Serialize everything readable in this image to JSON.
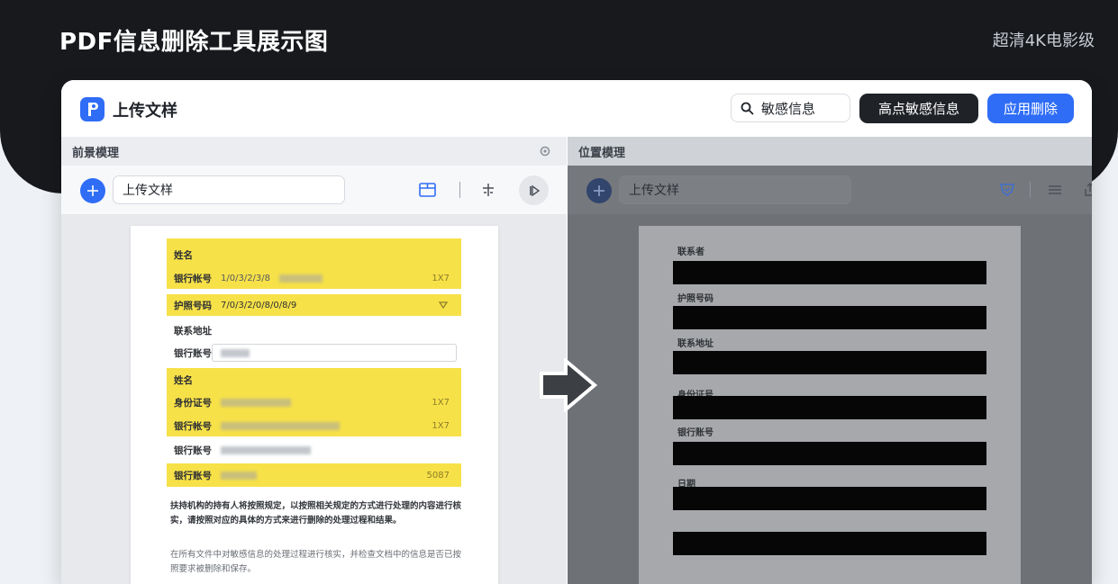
{
  "header": {
    "title": "PDF信息删除工具展示图",
    "quality": "超清4K电影级"
  },
  "app": {
    "name": "上传文样",
    "search_value": "敏感信息",
    "highlight_button": "高点敏感信息",
    "apply_button": "应用删除"
  },
  "left_pane": {
    "title": "前景模理",
    "file_field": "上传文样",
    "document": {
      "highlight_heading_1": "姓名",
      "rows": [
        {
          "label": "银行帐号",
          "value": "1/0/3/2/3/8",
          "code": "1X7"
        },
        {
          "label": "护照号码",
          "value": "7/0/3/2/0/8/0/8/9",
          "code": ""
        },
        {
          "label": "联系地址",
          "value": "",
          "code": ""
        },
        {
          "label": "银行账号",
          "value": "",
          "code": ""
        },
        {
          "label": "身份证号",
          "value": "",
          "code": "1X7"
        },
        {
          "label": "银行帐号",
          "value": "",
          "code": "1X7"
        },
        {
          "label": "银行账号",
          "value": "",
          "code": ""
        },
        {
          "label": "银行账号",
          "value": "",
          "code": "5087"
        }
      ],
      "highlight_heading_2": "姓名",
      "paragraph_1": "扶持机构的持有人将按照规定，以按照相关规定的方式进行处理的内容进行核实，请按照对应的具体的方式来进行删除的处理过程和结果。",
      "paragraph_2": "在所有文件中对敏感信息的处理过程进行核实，并检查文档中的信息是否已按照要求被删除和保存。"
    }
  },
  "right_pane": {
    "title": "位置模理",
    "file_field": "上传文样",
    "labels": [
      "联系者",
      "护照号码",
      "联系地址",
      "身份证号",
      "银行账号",
      "日期"
    ]
  },
  "colors": {
    "accent": "#2f6df6",
    "highlight": "#f7e148",
    "redaction": "#060606",
    "dark": "#17191d"
  },
  "icons": {
    "logo": "pdf-logo-icon",
    "search": "search-icon",
    "eye": "eye-icon",
    "arrow": "right-arrow-icon"
  }
}
